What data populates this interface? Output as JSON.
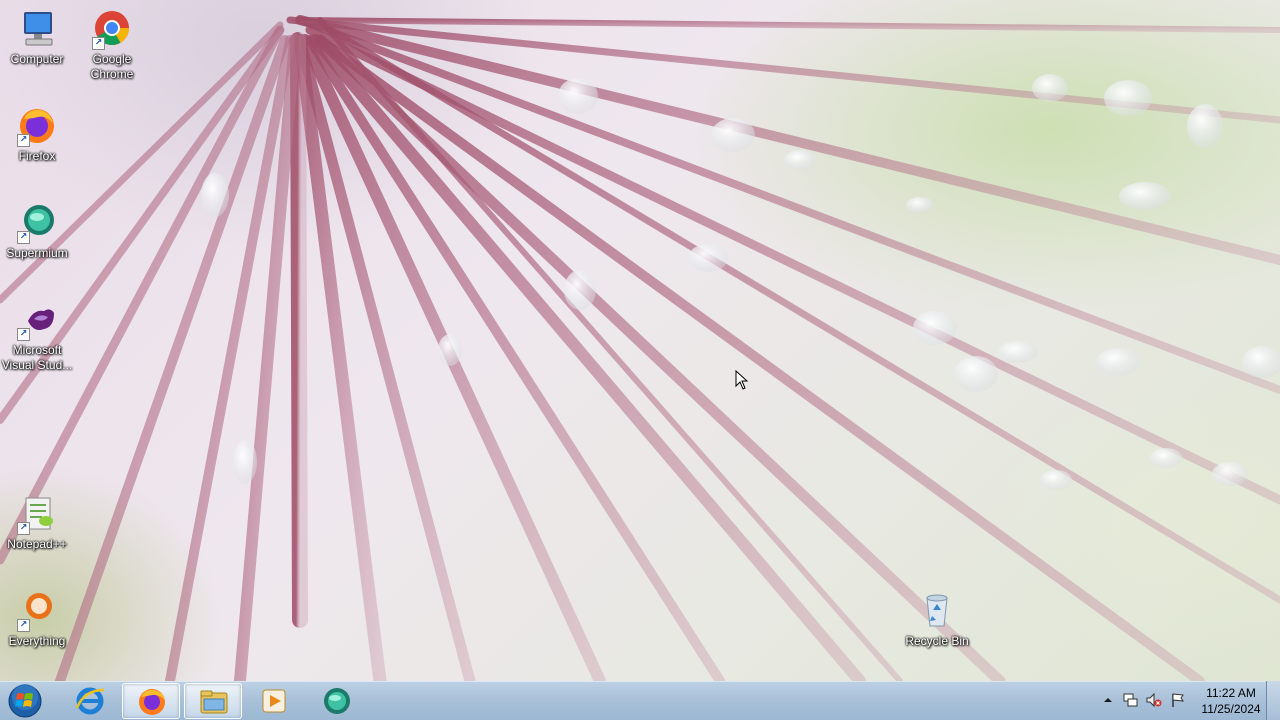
{
  "desktop": {
    "icons": [
      {
        "label": "Computer"
      },
      {
        "label": "Google Chrome"
      },
      {
        "label": "Firefox"
      },
      {
        "label": "Supermium"
      },
      {
        "label": "Microsoft Visual Stud..."
      },
      {
        "label": "Notepad++"
      },
      {
        "label": "Everything"
      },
      {
        "label": "Recycle Bin"
      }
    ]
  },
  "taskbar": {
    "pinned": [
      {
        "icon": "internet-explorer-icon"
      },
      {
        "icon": "firefox-icon"
      },
      {
        "icon": "windows-explorer-icon"
      },
      {
        "icon": "media-player-icon"
      },
      {
        "icon": "supermium-icon"
      }
    ],
    "tray": {
      "icons": [
        "show-hidden-icons-arrow",
        "network-icon",
        "volume-muted-icon",
        "action-center-flag-icon"
      ]
    },
    "clock": {
      "time": "11:22 AM",
      "date": "11/25/2024"
    }
  },
  "colors": {
    "taskbar": "#a9c1d9",
    "wallpaper_accent": "#b25b78"
  }
}
